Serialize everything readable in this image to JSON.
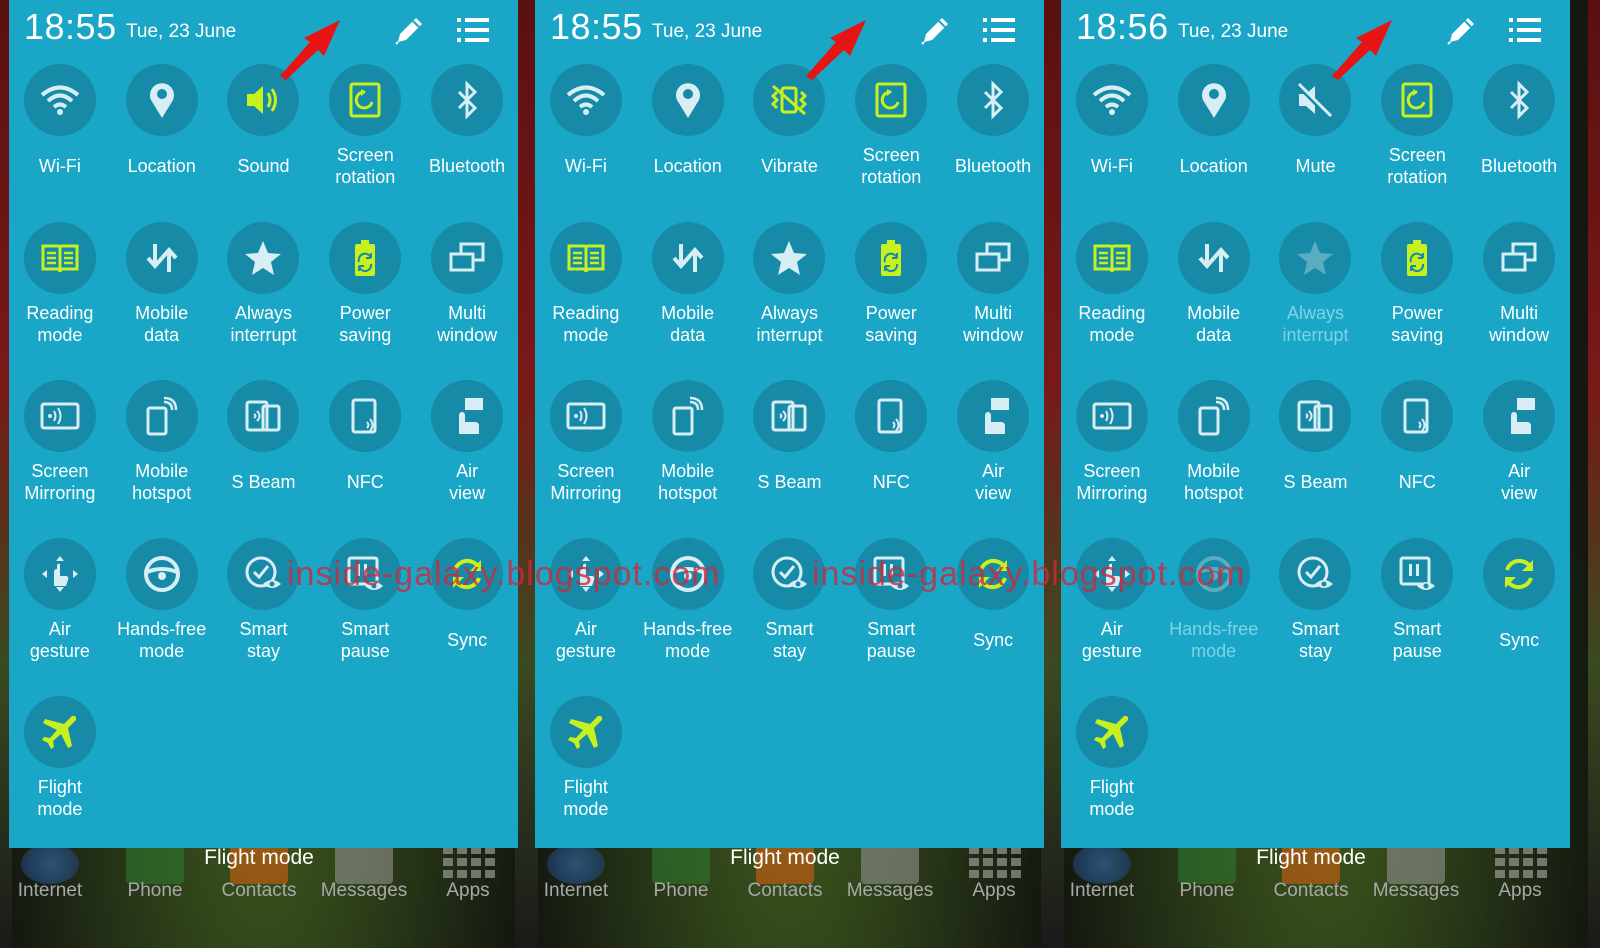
{
  "screens": [
    {
      "time": "18:55",
      "date": "Tue, 23 June",
      "sound_label": "Sound",
      "sound_mode": "sound",
      "disabled": []
    },
    {
      "time": "18:55",
      "date": "Tue, 23 June",
      "sound_label": "Vibrate",
      "sound_mode": "vibrate",
      "disabled": []
    },
    {
      "time": "18:56",
      "date": "Tue, 23 June",
      "sound_label": "Mute",
      "sound_mode": "mute",
      "disabled": [
        "always-interrupt",
        "hands-free-mode"
      ]
    }
  ],
  "tiles": [
    {
      "id": "wifi",
      "label": "Wi-Fi",
      "icon": "wifi-icon",
      "active": false
    },
    {
      "id": "location",
      "label": "Location",
      "icon": "location-icon",
      "active": false
    },
    {
      "id": "sound",
      "label": "",
      "icon": "sound-icon",
      "active": true
    },
    {
      "id": "screen-rotation",
      "label": "Screen\nrotation",
      "icon": "screen-rotation-icon",
      "active": true
    },
    {
      "id": "bluetooth",
      "label": "Bluetooth",
      "icon": "bluetooth-icon",
      "active": false
    },
    {
      "id": "reading-mode",
      "label": "Reading\nmode",
      "icon": "reading-mode-icon",
      "active": true
    },
    {
      "id": "mobile-data",
      "label": "Mobile\ndata",
      "icon": "mobile-data-icon",
      "active": false
    },
    {
      "id": "always-interrupt",
      "label": "Always\ninterrupt",
      "icon": "star-icon",
      "active": false
    },
    {
      "id": "power-saving",
      "label": "Power\nsaving",
      "icon": "power-saving-icon",
      "active": true
    },
    {
      "id": "multi-window",
      "label": "Multi\nwindow",
      "icon": "multi-window-icon",
      "active": false
    },
    {
      "id": "screen-mirroring",
      "label": "Screen\nMirroring",
      "icon": "screen-mirroring-icon",
      "active": false
    },
    {
      "id": "mobile-hotspot",
      "label": "Mobile\nhotspot",
      "icon": "mobile-hotspot-icon",
      "active": false
    },
    {
      "id": "s-beam",
      "label": "S Beam",
      "icon": "s-beam-icon",
      "active": false
    },
    {
      "id": "nfc",
      "label": "NFC",
      "icon": "nfc-icon",
      "active": false
    },
    {
      "id": "air-view",
      "label": "Air\nview",
      "icon": "air-view-icon",
      "active": false
    },
    {
      "id": "air-gesture",
      "label": "Air\ngesture",
      "icon": "air-gesture-icon",
      "active": false
    },
    {
      "id": "hands-free-mode",
      "label": "Hands-free\nmode",
      "icon": "steering-wheel-icon",
      "active": false
    },
    {
      "id": "smart-stay",
      "label": "Smart\nstay",
      "icon": "smart-stay-icon",
      "active": false
    },
    {
      "id": "smart-pause",
      "label": "Smart\npause",
      "icon": "smart-pause-icon",
      "active": false
    },
    {
      "id": "sync",
      "label": "Sync",
      "icon": "sync-icon",
      "active": true
    },
    {
      "id": "flight-mode",
      "label": "Flight\nmode",
      "icon": "airplane-icon",
      "active": true
    }
  ],
  "dock": {
    "toast": "Flight mode",
    "items": [
      "Internet",
      "Phone",
      "Contacts",
      "Messages",
      "Apps"
    ]
  },
  "watermark": "inside-galaxy.blogspot.com",
  "colors": {
    "panel": "#1aa6c7",
    "tile_circle": "#168aa6",
    "icon_active": "#c8f01e",
    "icon_inactive": "#d7eef4",
    "arrow": "#e81414"
  }
}
